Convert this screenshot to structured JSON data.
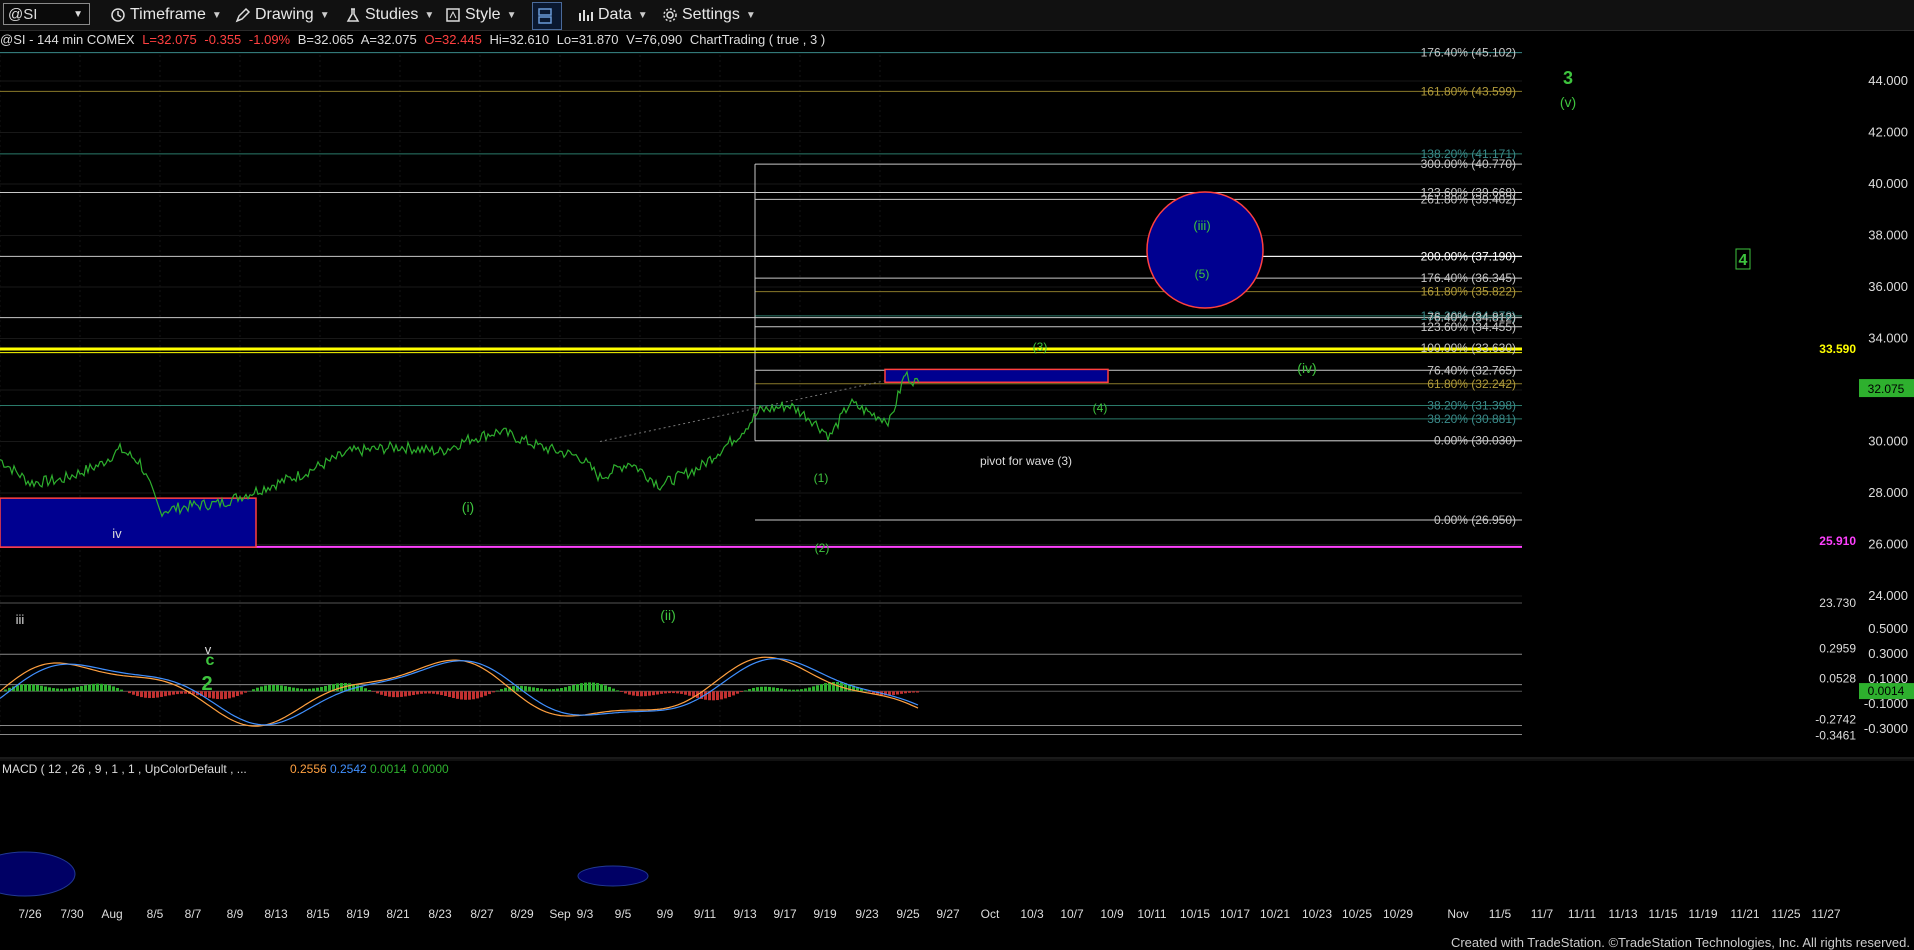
{
  "toolbar": {
    "symbol": "@SI",
    "timeframe": "Timeframe",
    "drawing": "Drawing",
    "studies": "Studies",
    "style": "Style",
    "data": "Data",
    "settings": "Settings"
  },
  "info_bar": {
    "symbol_desc": "@SI - 144 min COMEX",
    "last": "L=32.075",
    "change": "-0.355",
    "change_pct": "-1.09%",
    "bid": "B=32.065",
    "ask": "A=32.075",
    "open": "O=32.445",
    "high": "Hi=32.610",
    "low": "Lo=31.870",
    "volume": "V=76,090",
    "study": "ChartTrading ( true , 3 )"
  },
  "colors": {
    "green": "#3ec43e",
    "red": "#ff4040",
    "orange": "#ffa040",
    "blue": "#4090ff",
    "yellow": "#ffff00",
    "magenta": "#ff40ff",
    "navy": "#000090"
  },
  "price_axis": {
    "labels": [
      "44.000",
      "42.000",
      "40.000",
      "38.000",
      "36.000",
      "34.000",
      "32.000",
      "30.000",
      "28.000",
      "26.000",
      "24.000"
    ],
    "current_price": "32.075",
    "magenta_level": "25.910",
    "bottom_level": "23.730",
    "yellow_level": "33.590"
  },
  "fib_labels": [
    {
      "text": "176.40% (45.102)",
      "price": 45.102,
      "color": "#c8c8c8"
    },
    {
      "text": "161.80% (43.599)",
      "price": 43.599,
      "color": "#b09a3a"
    },
    {
      "text": "138.20% (41.171)",
      "price": 41.171,
      "color": "#3a8a8a"
    },
    {
      "text": "300.00% (40.770)",
      "price": 40.77,
      "color": "#c8c8c8"
    },
    {
      "text": "123.60% (39.668)",
      "price": 39.668,
      "color": "#c8c8c8"
    },
    {
      "text": "261.80% (39.402)",
      "price": 39.402,
      "color": "#c8c8c8"
    },
    {
      "text": "200.00% (37.190)",
      "price": 37.19,
      "color": "#ffffff"
    },
    {
      "text": "176.40% (36.345)",
      "price": 36.345,
      "color": "#c8c8c8"
    },
    {
      "text": "161.80% (35.822)",
      "price": 35.822,
      "color": "#b09a3a"
    },
    {
      "text": "138.20% (34.878)",
      "price": 34.878,
      "color": "#3a8a8a"
    },
    {
      "text": "76.40% (34.812)",
      "price": 34.812,
      "color": "#c8c8c8"
    },
    {
      "text": "123.60% (34.455)",
      "price": 34.455,
      "color": "#c8c8c8"
    },
    {
      "text": "100.00% (33.630)",
      "price": 33.63,
      "color": "#c8c8c8"
    },
    {
      "text": "76.40% (32.765)",
      "price": 32.765,
      "color": "#c8c8c8"
    },
    {
      "text": "61.80% (32.242)",
      "price": 32.242,
      "color": "#b09a3a"
    },
    {
      "text": "38.20% (31.398)",
      "price": 31.398,
      "color": "#3a8a8a"
    },
    {
      "text": "38.20% (30.881)",
      "price": 30.881,
      "color": "#3a8a8a"
    },
    {
      "text": "0.00% (30.030)",
      "price": 30.03,
      "color": "#c8c8c8"
    },
    {
      "text": "0.00% (26.950)",
      "price": 26.95,
      "color": "#c8c8c8"
    }
  ],
  "wave_labels": {
    "w3_big": "3",
    "wv": "(v)",
    "wiii": "(iii)",
    "w5": "(5)",
    "w4_big": "4",
    "w3p": "(3)",
    "wiv": "(iv)",
    "w4p": "(4)",
    "w1p": "(1)",
    "w2p": "(2)",
    "wi": "(i)",
    "wii": "(ii)",
    "iv": "iv",
    "iii": "iii",
    "v": "v",
    "c": "c",
    "w2_big": "2",
    "pivot": "pivot for wave (3)"
  },
  "macd": {
    "title": "MACD ( 12 , 26 , 9 , 1 , 1 , UpColorDefault , ...",
    "v1": "0.2556",
    "v2": "0.2542",
    "v3": "0.0014",
    "v4": "0.0000",
    "axis": [
      "0.5000",
      "0.3000",
      "0.1000",
      "-0.1000",
      "-0.3000"
    ],
    "levels": [
      "0.2959",
      "0.0528",
      "-0.2742",
      "-0.3461"
    ],
    "current": "0.0014"
  },
  "date_axis": [
    "7/26",
    "7/30",
    "Aug",
    "8/5",
    "8/7",
    "8/9",
    "8/13",
    "8/15",
    "8/19",
    "8/21",
    "8/23",
    "8/27",
    "8/29",
    "Sep",
    "9/3",
    "9/5",
    "9/9",
    "9/11",
    "9/13",
    "9/17",
    "9/19",
    "9/23",
    "9/25",
    "9/27",
    "Oct",
    "10/3",
    "10/7",
    "10/9",
    "10/11",
    "10/15",
    "10/17",
    "10/21",
    "10/23",
    "10/25",
    "10/29",
    "Nov",
    "11/5",
    "11/7",
    "11/11",
    "11/13",
    "11/15",
    "11/19",
    "11/21",
    "11/25",
    "11/27"
  ],
  "footer": "Created with TradeStation. ©TradeStation Technologies, Inc. All rights reserved."
}
